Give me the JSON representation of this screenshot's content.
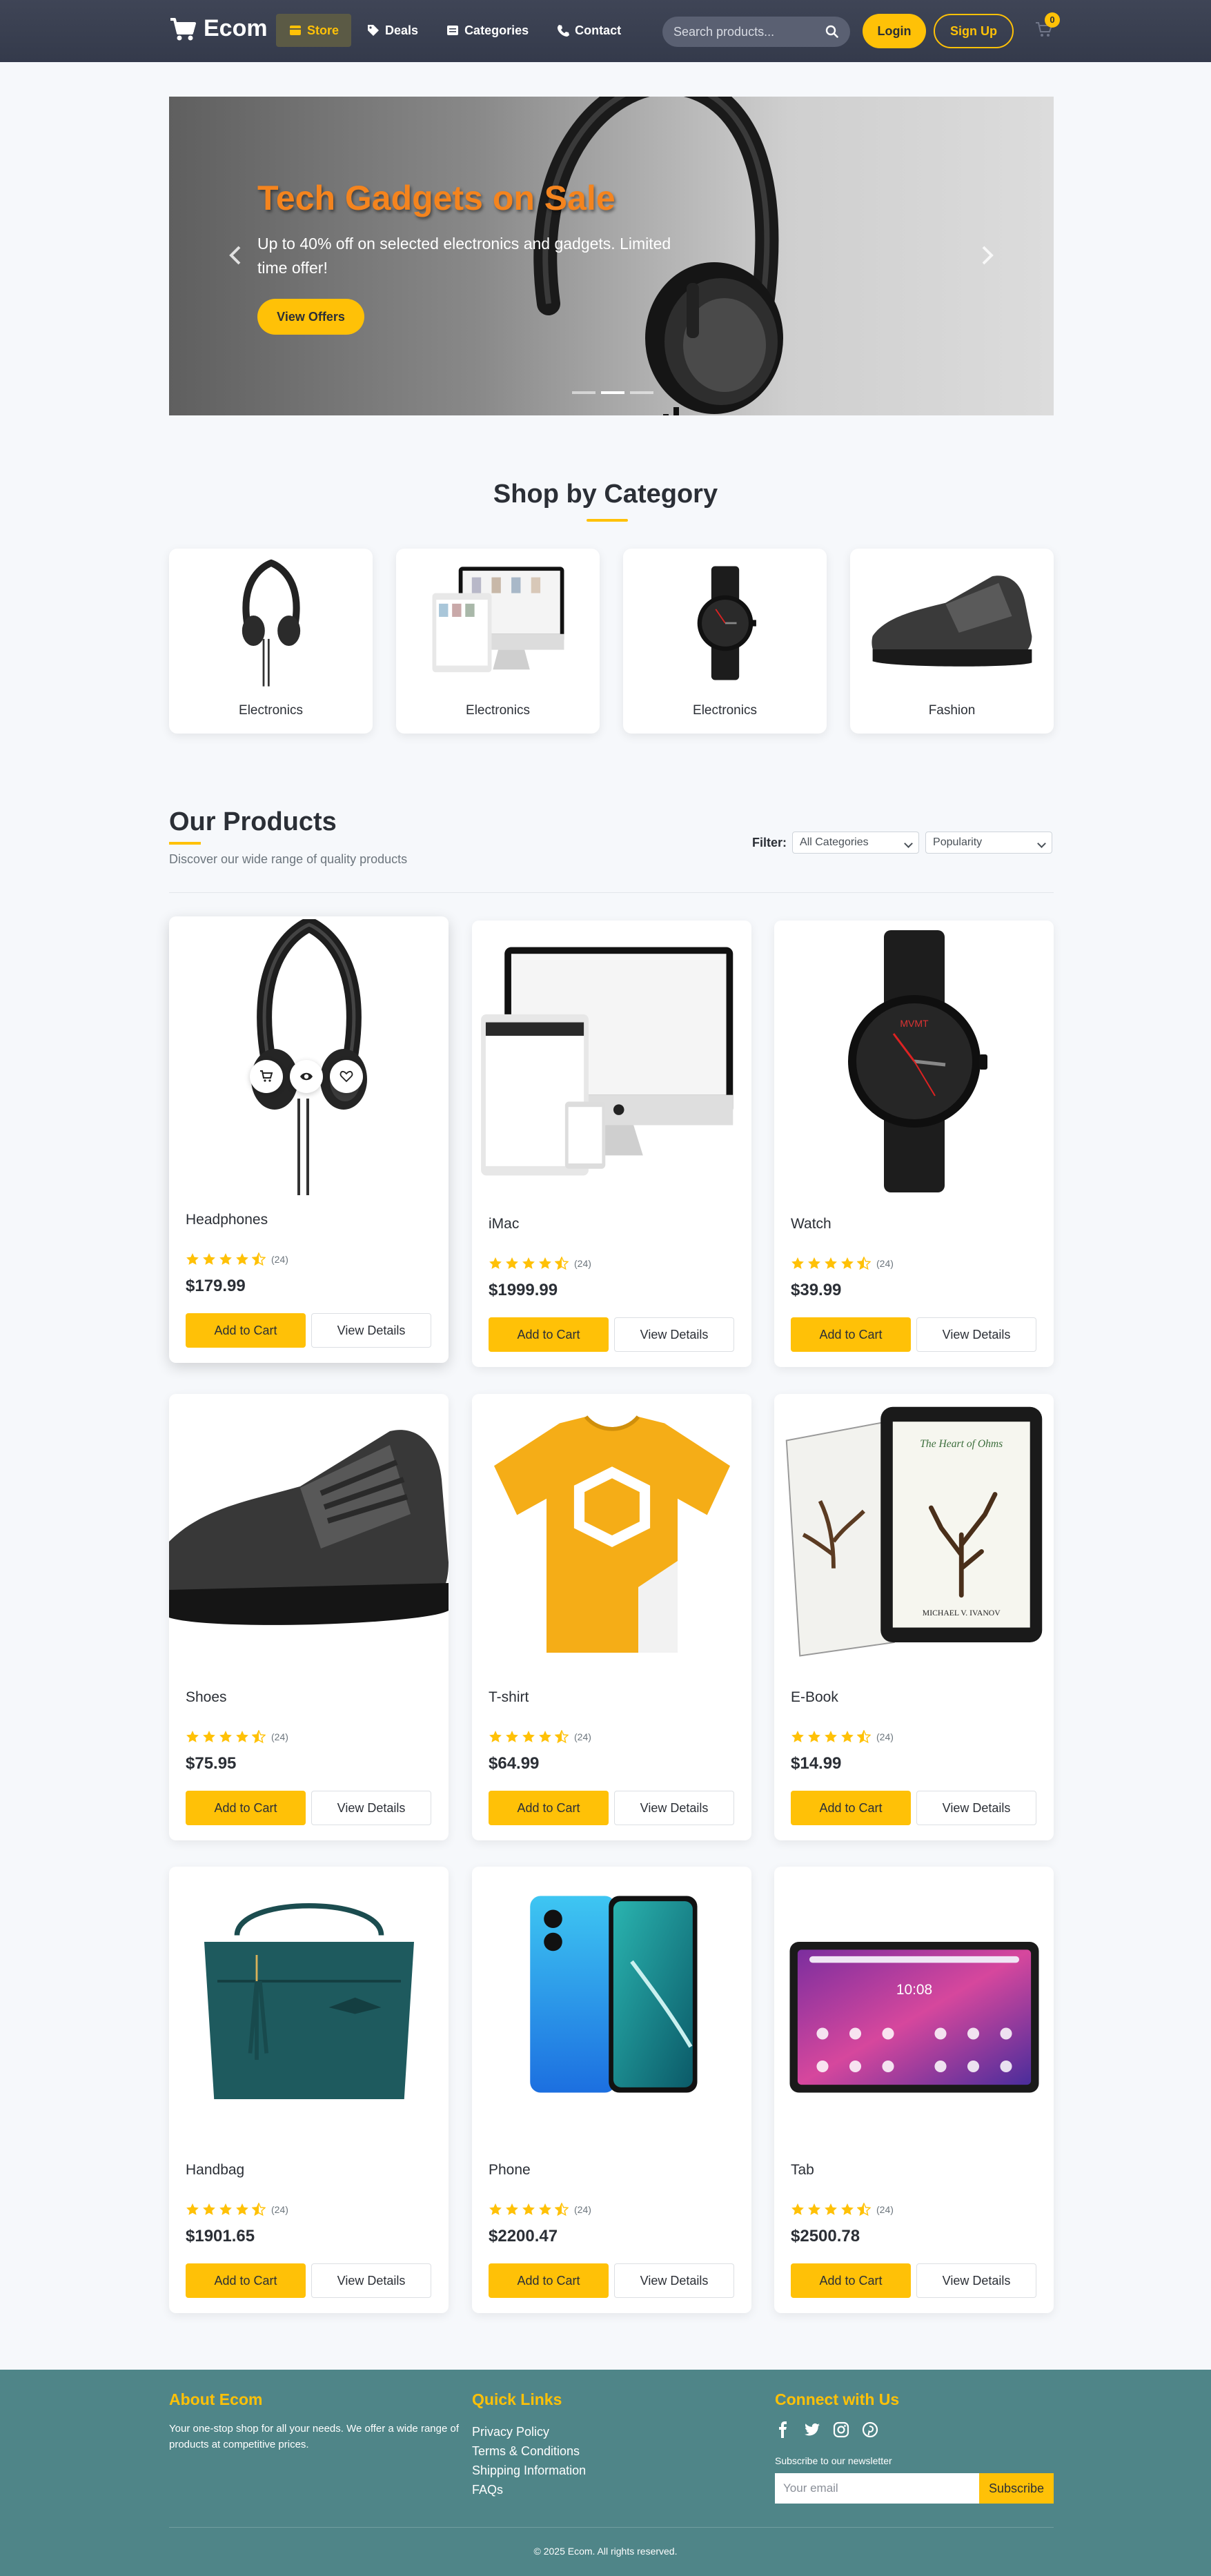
{
  "navbar": {
    "brand": "Ecom",
    "links": [
      {
        "label": "Store",
        "icon": "store-icon",
        "active": true
      },
      {
        "label": "Deals",
        "icon": "tag-icon",
        "active": false
      },
      {
        "label": "Categories",
        "icon": "list-icon",
        "active": false
      },
      {
        "label": "Contact",
        "icon": "phone-icon",
        "active": false
      }
    ],
    "search_placeholder": "Search products...",
    "login_label": "Login",
    "signup_label": "Sign Up",
    "cart_count": "0"
  },
  "hero": {
    "title": "Tech Gadgets on Sale",
    "subtitle": "Up to 40% off on selected electronics and gadgets. Limited time offer!",
    "button_label": "View Offers",
    "slide_count": 3,
    "active_slide": 2
  },
  "categories": {
    "title": "Shop by Category",
    "items": [
      {
        "label": "Electronics",
        "image": "headphones"
      },
      {
        "label": "Electronics",
        "image": "imac"
      },
      {
        "label": "Electronics",
        "image": "watch"
      },
      {
        "label": "Fashion",
        "image": "shoe"
      }
    ]
  },
  "products": {
    "title": "Our Products",
    "subtitle": "Discover our wide range of quality products",
    "filter_label": "Filter:",
    "category_select": "All Categories",
    "sort_select": "Popularity",
    "add_label": "Add to Cart",
    "view_label": "View Details",
    "items": [
      {
        "name": "Headphones",
        "rating": 4.5,
        "reviews": "(24)",
        "price": "$179.99"
      },
      {
        "name": "iMac",
        "rating": 4.5,
        "reviews": "(24)",
        "price": "$1999.99"
      },
      {
        "name": "Watch",
        "rating": 4.5,
        "reviews": "(24)",
        "price": "$39.99"
      },
      {
        "name": "Shoes",
        "rating": 4.5,
        "reviews": "(24)",
        "price": "$75.95"
      },
      {
        "name": "T-shirt",
        "rating": 4.5,
        "reviews": "(24)",
        "price": "$64.99"
      },
      {
        "name": "E-Book",
        "rating": 4.5,
        "reviews": "(24)",
        "price": "$14.99"
      },
      {
        "name": "Handbag",
        "rating": 4.5,
        "reviews": "(24)",
        "price": "$1901.65"
      },
      {
        "name": "Phone",
        "rating": 4.5,
        "reviews": "(24)",
        "price": "$2200.47"
      },
      {
        "name": "Tab",
        "rating": 4.5,
        "reviews": "(24)",
        "price": "$2500.78"
      }
    ],
    "ebook_cover_text": "The Heart of Ohms",
    "ebook_author": "MICHAEL V. IVANOV",
    "tab_clock": "10:08",
    "watch_brand": "MVMT"
  },
  "footer": {
    "about_title": "About Ecom",
    "about_text": "Your one-stop shop for all your needs. We offer a wide range of products at competitive prices.",
    "links_title": "Quick Links",
    "links": [
      "Privacy Policy",
      "Terms & Conditions",
      "Shipping Information",
      "FAQs"
    ],
    "connect_title": "Connect with Us",
    "social_icons": [
      "facebook-icon",
      "twitter-icon",
      "instagram-icon",
      "pinterest-icon"
    ],
    "newsletter_label": "Subscribe to our newsletter",
    "newsletter_placeholder": "Your email",
    "subscribe_label": "Subscribe",
    "copyright": "© 2025 Ecom. All rights reserved."
  },
  "colors": {
    "accent": "#ffc107",
    "navbar": "#3b4152",
    "footer": "#4f8588",
    "hero_title": "#f4841e",
    "star": "#ffc107"
  }
}
